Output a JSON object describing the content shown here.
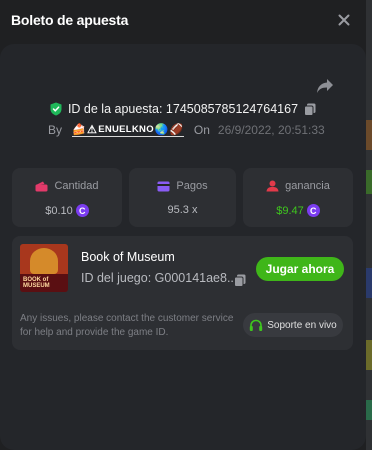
{
  "modal": {
    "title": "Boleto de apuesta",
    "close_icon": "close-icon"
  },
  "bet": {
    "id_text": "ID de la apuesta: 1745085785124764167",
    "by_label": "By",
    "username": "ENUELKNO",
    "on_label": "On",
    "date": "26/9/2022, 20:51:33"
  },
  "stats": {
    "amount": {
      "label": "Cantidad",
      "value": "$0.10",
      "icon": "wallet-icon"
    },
    "payout": {
      "label": "Pagos",
      "value": "95.3 x",
      "icon": "card-icon"
    },
    "profit": {
      "label": "ganancia",
      "value": "$9.47",
      "icon": "profit-icon"
    }
  },
  "game": {
    "name": "Book of Museum",
    "id_text": "ID del juego: G000141ae8...",
    "thumb_caption": "BOOK of MUSEUM",
    "play_label": "Jugar ahora",
    "notice": "Any issues, please contact the customer service for help and provide the game ID.",
    "support_label": "Soporte en vivo"
  },
  "colors": {
    "background": "#1f2022",
    "panel": "#24262a",
    "card": "#2d2f33",
    "accent_green": "#3fb619",
    "coin_purple": "#7b3cf0",
    "shield_green": "#1fb85a",
    "profit_red": "#e23a4a"
  }
}
